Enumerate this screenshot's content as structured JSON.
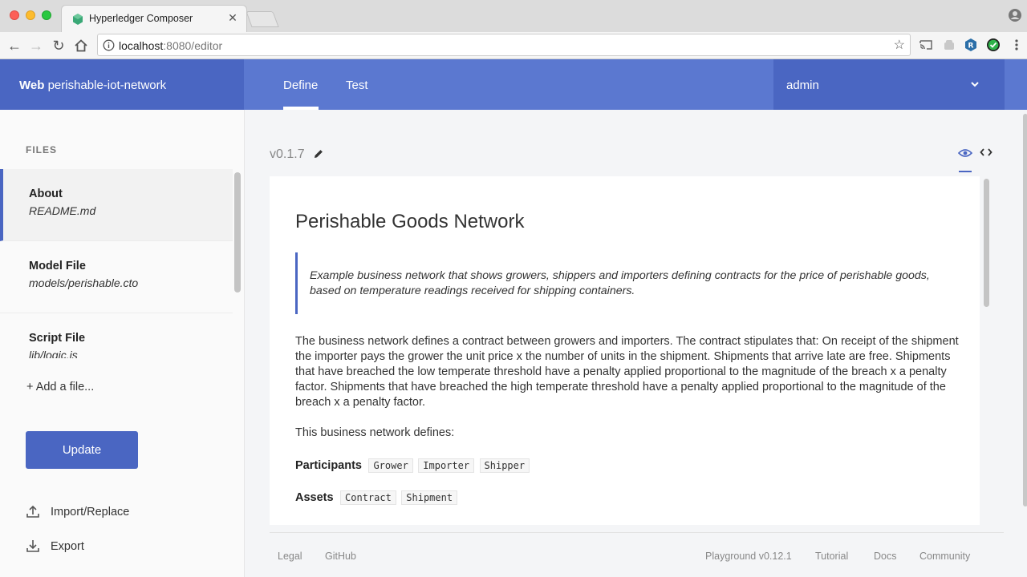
{
  "browser": {
    "tab_title": "Hyperledger Composer",
    "url_host": "localhost",
    "url_rest": ":8080/editor"
  },
  "header": {
    "brand_bold": "Web",
    "brand_rest": "perishable-iot-network",
    "nav": [
      "Define",
      "Test"
    ],
    "active_nav": "Define",
    "user": "admin",
    "accent": "#5b78d0",
    "accent_dark": "#4a66c2"
  },
  "sidebar": {
    "heading": "FILES",
    "files": [
      {
        "title": "About",
        "path": "README.md"
      },
      {
        "title": "Model File",
        "path": "models/perishable.cto"
      },
      {
        "title": "Script File",
        "path": "lib/logic.js"
      }
    ],
    "add_file": "+ Add a file...",
    "update": "Update",
    "import": "Import/Replace",
    "export": "Export"
  },
  "main": {
    "version": "v0.1.7",
    "doc": {
      "title": "Perishable Goods Network",
      "quote": "Example business network that shows growers, shippers and importers defining contracts for the price of perishable goods, based on temperature readings received for shipping containers.",
      "paragraph": "The business network defines a contract between growers and importers. The contract stipulates that: On receipt of the shipment the importer pays the grower the unit price x the number of units in the shipment. Shipments that arrive late are free. Shipments that have breached the low temperate threshold have a penalty applied proportional to the magnitude of the breach x a penalty factor. Shipments that have breached the high temperate threshold have a penalty applied proportional to the magnitude of the breach x a penalty factor.",
      "defines": "This business network defines:",
      "participants_label": "Participants",
      "participants": [
        "Grower",
        "Importer",
        "Shipper"
      ],
      "assets_label": "Assets",
      "assets": [
        "Contract",
        "Shipment"
      ]
    }
  },
  "footer": {
    "legal": "Legal",
    "github": "GitHub",
    "version": "Playground v0.12.1",
    "tutorial": "Tutorial",
    "docs": "Docs",
    "community": "Community"
  }
}
